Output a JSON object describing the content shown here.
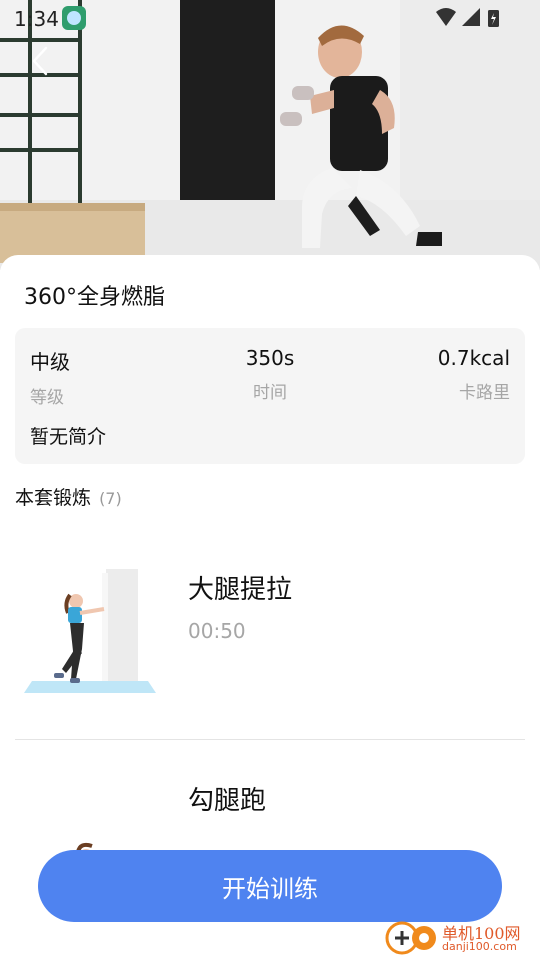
{
  "status_bar": {
    "time": "1:34"
  },
  "workout": {
    "title": "360°全身燃脂",
    "stats": [
      {
        "value": "中级",
        "label": "等级"
      },
      {
        "value": "350s",
        "label": "时间"
      },
      {
        "value": "0.7kcal",
        "label": "卡路里"
      }
    ],
    "intro": "暂无简介"
  },
  "section": {
    "title": "本套锻炼",
    "count": "(7)"
  },
  "exercises": [
    {
      "name": "大腿提拉",
      "duration": "00:50"
    },
    {
      "name": "勾腿跑"
    }
  ],
  "start_button": {
    "label": "开始训练",
    "color": "#4f83f0"
  },
  "watermark": {
    "name": "单机100网",
    "url": "danji100.com"
  },
  "icons": [
    "back-arrow-icon",
    "wifi-icon",
    "signal-icon",
    "battery-icon",
    "app-badge-icon"
  ]
}
